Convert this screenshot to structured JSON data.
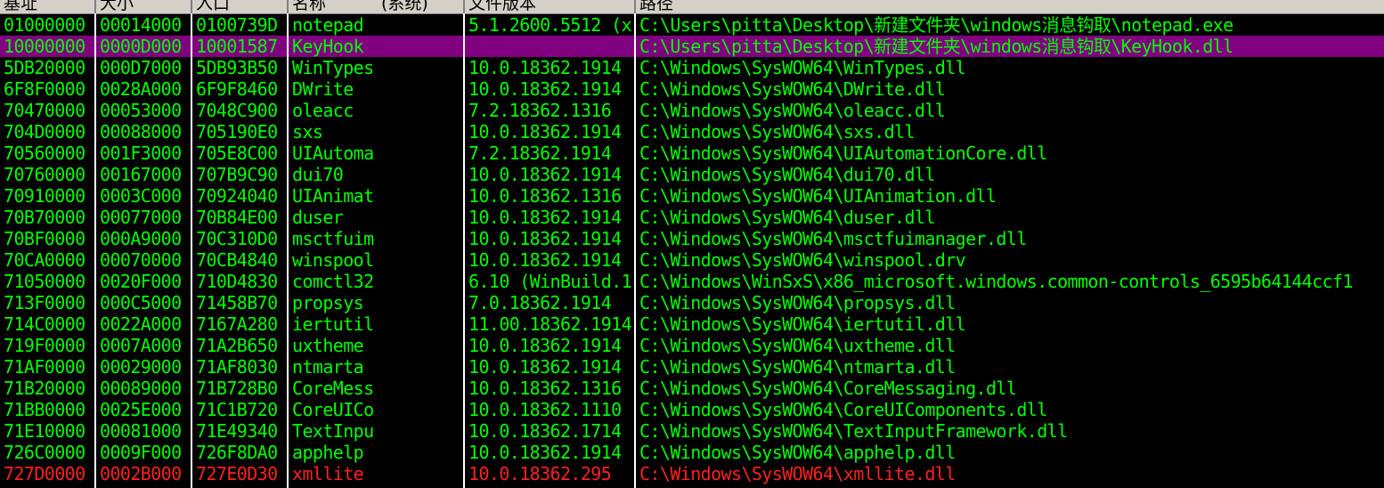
{
  "colors": {
    "background": "#000000",
    "text_normal": "#00ff00",
    "text_highlight": "#ff2020",
    "selected_row_bg": "#800080",
    "header_bg": "#d4d0c8"
  },
  "columns": [
    "基址",
    "大小",
    "入口",
    "名称",
    "(系统)",
    "文件版本",
    "路径"
  ],
  "rows": [
    {
      "base": "01000000",
      "size": "00014000",
      "entry": "0100739D",
      "name": "notepad",
      "version": "5.1.2600.5512 (x",
      "path": "C:\\Users\\pitta\\Desktop\\新建文件夹\\windows消息钩取\\notepad.exe",
      "selected": false,
      "highlight": false
    },
    {
      "base": "10000000",
      "size": "0000D000",
      "entry": "10001587",
      "name": "KeyHook",
      "version": "",
      "path": "C:\\Users\\pitta\\Desktop\\新建文件夹\\windows消息钩取\\KeyHook.dll",
      "selected": true,
      "highlight": false
    },
    {
      "base": "5DB20000",
      "size": "000D7000",
      "entry": "5DB93B50",
      "name": "WinTypes",
      "version": "10.0.18362.1914",
      "path": "C:\\Windows\\SysWOW64\\WinTypes.dll",
      "selected": false,
      "highlight": false
    },
    {
      "base": "6F8F0000",
      "size": "0028A000",
      "entry": "6F9F8460",
      "name": "DWrite",
      "version": "10.0.18362.1914",
      "path": "C:\\Windows\\SysWOW64\\DWrite.dll",
      "selected": false,
      "highlight": false
    },
    {
      "base": "70470000",
      "size": "00053000",
      "entry": "7048C900",
      "name": "oleacc",
      "version": "7.2.18362.1316",
      "path": "C:\\Windows\\SysWOW64\\oleacc.dll",
      "selected": false,
      "highlight": false
    },
    {
      "base": "704D0000",
      "size": "00088000",
      "entry": "705190E0",
      "name": "sxs",
      "version": "10.0.18362.1914",
      "path": "C:\\Windows\\SysWOW64\\sxs.dll",
      "selected": false,
      "highlight": false
    },
    {
      "base": "70560000",
      "size": "001F3000",
      "entry": "705E8C00",
      "name": "UIAutoma",
      "version": "7.2.18362.1914",
      "path": "C:\\Windows\\SysWOW64\\UIAutomationCore.dll",
      "selected": false,
      "highlight": false
    },
    {
      "base": "70760000",
      "size": "00167000",
      "entry": "707B9C90",
      "name": "dui70",
      "version": "10.0.18362.1914",
      "path": "C:\\Windows\\SysWOW64\\dui70.dll",
      "selected": false,
      "highlight": false
    },
    {
      "base": "70910000",
      "size": "0003C000",
      "entry": "70924040",
      "name": "UIAnimat",
      "version": "10.0.18362.1316",
      "path": "C:\\Windows\\SysWOW64\\UIAnimation.dll",
      "selected": false,
      "highlight": false
    },
    {
      "base": "70B70000",
      "size": "00077000",
      "entry": "70B84E00",
      "name": "duser",
      "version": "10.0.18362.1914",
      "path": "C:\\Windows\\SysWOW64\\duser.dll",
      "selected": false,
      "highlight": false
    },
    {
      "base": "70BF0000",
      "size": "000A9000",
      "entry": "70C310D0",
      "name": "msctfuim",
      "version": "10.0.18362.1914",
      "path": "C:\\Windows\\SysWOW64\\msctfuimanager.dll",
      "selected": false,
      "highlight": false
    },
    {
      "base": "70CA0000",
      "size": "00070000",
      "entry": "70CB4840",
      "name": "winspool",
      "version": "10.0.18362.1914",
      "path": "C:\\Windows\\SysWOW64\\winspool.drv",
      "selected": false,
      "highlight": false
    },
    {
      "base": "71050000",
      "size": "0020F000",
      "entry": "710D4830",
      "name": "comctl32",
      "version": "6.10 (WinBuild.1",
      "path": "C:\\Windows\\WinSxS\\x86_microsoft.windows.common-controls_6595b64144ccf1",
      "selected": false,
      "highlight": false
    },
    {
      "base": "713F0000",
      "size": "000C5000",
      "entry": "71458B70",
      "name": "propsys",
      "version": "7.0.18362.1914",
      "path": "C:\\Windows\\SysWOW64\\propsys.dll",
      "selected": false,
      "highlight": false
    },
    {
      "base": "714C0000",
      "size": "0022A000",
      "entry": "7167A280",
      "name": "iertutil",
      "version": "11.00.18362.1914",
      "path": "C:\\Windows\\SysWOW64\\iertutil.dll",
      "selected": false,
      "highlight": false
    },
    {
      "base": "719F0000",
      "size": "0007A000",
      "entry": "71A2B650",
      "name": "uxtheme",
      "version": "10.0.18362.1914",
      "path": "C:\\Windows\\SysWOW64\\uxtheme.dll",
      "selected": false,
      "highlight": false
    },
    {
      "base": "71AF0000",
      "size": "00029000",
      "entry": "71AF8030",
      "name": "ntmarta",
      "version": "10.0.18362.1914",
      "path": "C:\\Windows\\SysWOW64\\ntmarta.dll",
      "selected": false,
      "highlight": false
    },
    {
      "base": "71B20000",
      "size": "00089000",
      "entry": "71B728B0",
      "name": "CoreMess",
      "version": "10.0.18362.1316",
      "path": "C:\\Windows\\SysWOW64\\CoreMessaging.dll",
      "selected": false,
      "highlight": false
    },
    {
      "base": "71BB0000",
      "size": "0025E000",
      "entry": "71C1B720",
      "name": "CoreUICo",
      "version": "10.0.18362.1110",
      "path": "C:\\Windows\\SysWOW64\\CoreUIComponents.dll",
      "selected": false,
      "highlight": false
    },
    {
      "base": "71E10000",
      "size": "00081000",
      "entry": "71E49340",
      "name": "TextInpu",
      "version": "10.0.18362.1714",
      "path": "C:\\Windows\\SysWOW64\\TextInputFramework.dll",
      "selected": false,
      "highlight": false
    },
    {
      "base": "726C0000",
      "size": "0009F000",
      "entry": "726F8DA0",
      "name": "apphelp",
      "version": "10.0.18362.1914",
      "path": "C:\\Windows\\SysWOW64\\apphelp.dll",
      "selected": false,
      "highlight": false
    },
    {
      "base": "727D0000",
      "size": "0002B000",
      "entry": "727E0D30",
      "name": "xmllite",
      "version": "10.0.18362.295",
      "path": "C:\\Windows\\SysWOW64\\xmllite.dll",
      "selected": false,
      "highlight": true
    }
  ]
}
